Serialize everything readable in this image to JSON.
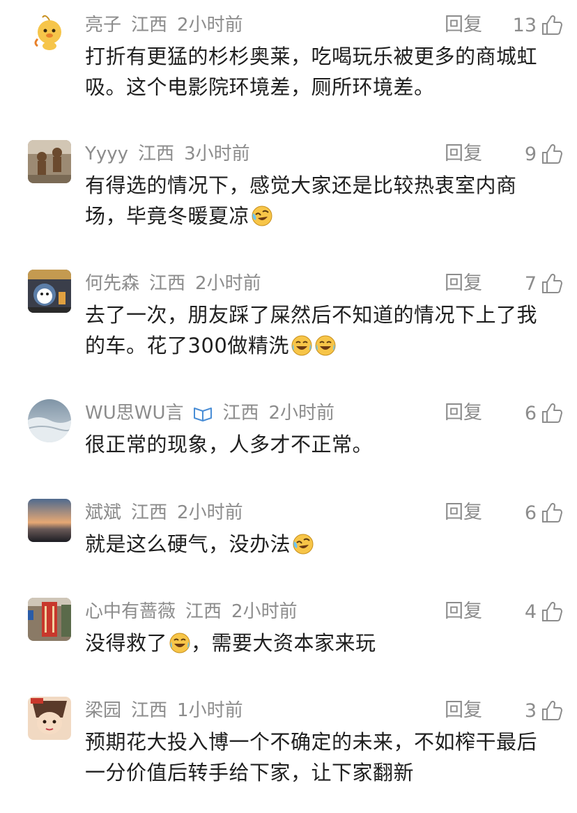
{
  "comments": [
    {
      "user": "亮子",
      "location": "江西",
      "time": "2小时前",
      "reply": "回复",
      "likes": "13",
      "lines": [
        "打折有更猛的杉杉奥莱，吃喝玩乐被更多的商城虹",
        "吸。这个电影院环境差，厕所环境差。"
      ]
    },
    {
      "user": "Yyyy",
      "location": "江西",
      "time": "3小时前",
      "reply": "回复",
      "likes": "9",
      "lines": [
        "有得选的情况下，感觉大家还是比较热衷室内商",
        "场，毕竟冬暖夏凉"
      ]
    },
    {
      "user": "何先森",
      "location": "江西",
      "time": "2小时前",
      "reply": "回复",
      "likes": "7",
      "lines": [
        "去了一次，朋友踩了屎然后不知道的情况下上了我",
        "的车。花了300做精洗"
      ]
    },
    {
      "user": "WU思WU言",
      "location": "江西",
      "time": "2小时前",
      "reply": "回复",
      "likes": "6",
      "lines": [
        "很正常的现象，人多才不正常。"
      ]
    },
    {
      "user": "斌斌",
      "location": "江西",
      "time": "2小时前",
      "reply": "回复",
      "likes": "6",
      "lines": [
        "就是这么硬气，没办法"
      ]
    },
    {
      "user": "心中有蔷薇",
      "location": "江西",
      "time": "2小时前",
      "reply": "回复",
      "likes": "4",
      "lines": [
        "没得救了",
        "，需要大资本家来玩"
      ]
    },
    {
      "user": "梁园",
      "location": "江西",
      "time": "1小时前",
      "reply": "回复",
      "likes": "3",
      "lines": [
        "预期花大投入博一个不确定的未来，不如榨干最后",
        "一分价值后转手给下家，让下家翻新"
      ]
    }
  ],
  "icons": {
    "like": "thumbs-up-icon",
    "vip": "open-book-badge-icon",
    "emoji_cry": "crying-laughing-emoji-icon",
    "emoji_joy": "tears-of-joy-emoji-icon"
  },
  "colors": {
    "meta": "#8c8c8c",
    "text": "#1f1f1f",
    "vip": "#4a8ed6"
  }
}
